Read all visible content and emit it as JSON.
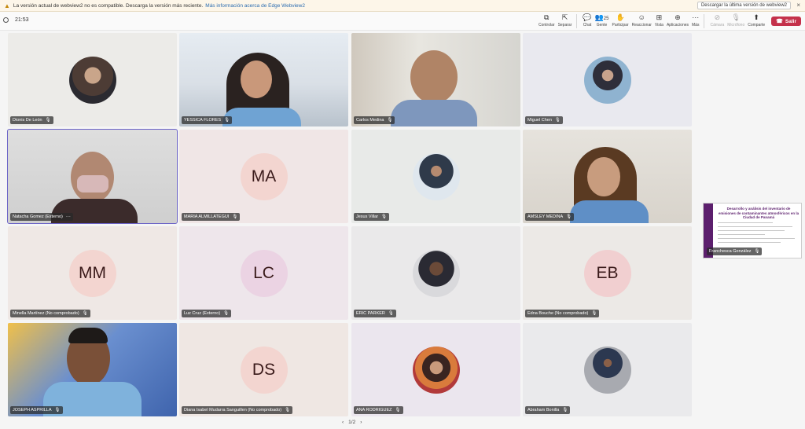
{
  "banner": {
    "warning_icon": "warning-icon",
    "message": "La versión actual de webview2 no es compatible. Descarga la versión más reciente.",
    "link_text": "Más información acerca de Edge Webview2",
    "download_button": "Descargar la última versión de webview2",
    "close_glyph": "×"
  },
  "toolbar": {
    "timer": "21:53",
    "buttons": {
      "controlar": "Controlar",
      "separar": "Separar",
      "chat": "Chat",
      "gente": "Gente",
      "gente_count": "25",
      "participar": "Participar",
      "reaccionar": "Reaccionar",
      "vista": "Vista",
      "aplicaciones": "Aplicaciones",
      "mas": "Más",
      "camara": "Cámara",
      "microfono": "Micrófono",
      "comparte": "Comparte"
    },
    "leave": "Salir"
  },
  "tiles": {
    "t1": {
      "name": "Dionis De León"
    },
    "t2": {
      "name": "YESSICA FLORES"
    },
    "t3": {
      "name": "Carlos Medina"
    },
    "t4": {
      "name": "Miguel Chen"
    },
    "t5": {
      "name": "Natacha Gomez (Externo)",
      "more": "···"
    },
    "t6": {
      "name": "MARIA ALMILLATEGUI",
      "initials": "MA"
    },
    "t7": {
      "name": "Jesus Villar"
    },
    "t8": {
      "name": "AMSLEY MEDINA"
    },
    "t9": {
      "name": "Minella Martínez (No comprobado)",
      "initials": "MM"
    },
    "t10": {
      "name": "Luz Cruz (Externo)",
      "initials": "LC"
    },
    "t11": {
      "name": "ERIC PARKER"
    },
    "t12": {
      "name": "Edna Bouche (No comprobado)",
      "initials": "EB"
    },
    "t13": {
      "name": "JOSEPH ASPRILLA"
    },
    "t14": {
      "name": "Diana Isabel Mudarra Sanguillen (No comprobado)",
      "initials": "DS"
    },
    "t15": {
      "name": "ANA RODRIGUEZ"
    },
    "t16": {
      "name": "Abraham Bonilla"
    }
  },
  "share": {
    "presenter": "Franchesca González",
    "doc_title": "Desarrollo y análisis del inventario de emisiones de contaminantes atmosféricos en la Ciudad de Panamá"
  },
  "pager": {
    "label": "1/2",
    "prev": "‹",
    "next": "›"
  },
  "colors": {
    "accent": "#6b63c7",
    "leave": "#c4314b",
    "initials_bg_pink": "#f3d5d0",
    "initials_bg_lilac": "#ebd3e3",
    "initials_bg_rose": "#f1cfd0"
  }
}
